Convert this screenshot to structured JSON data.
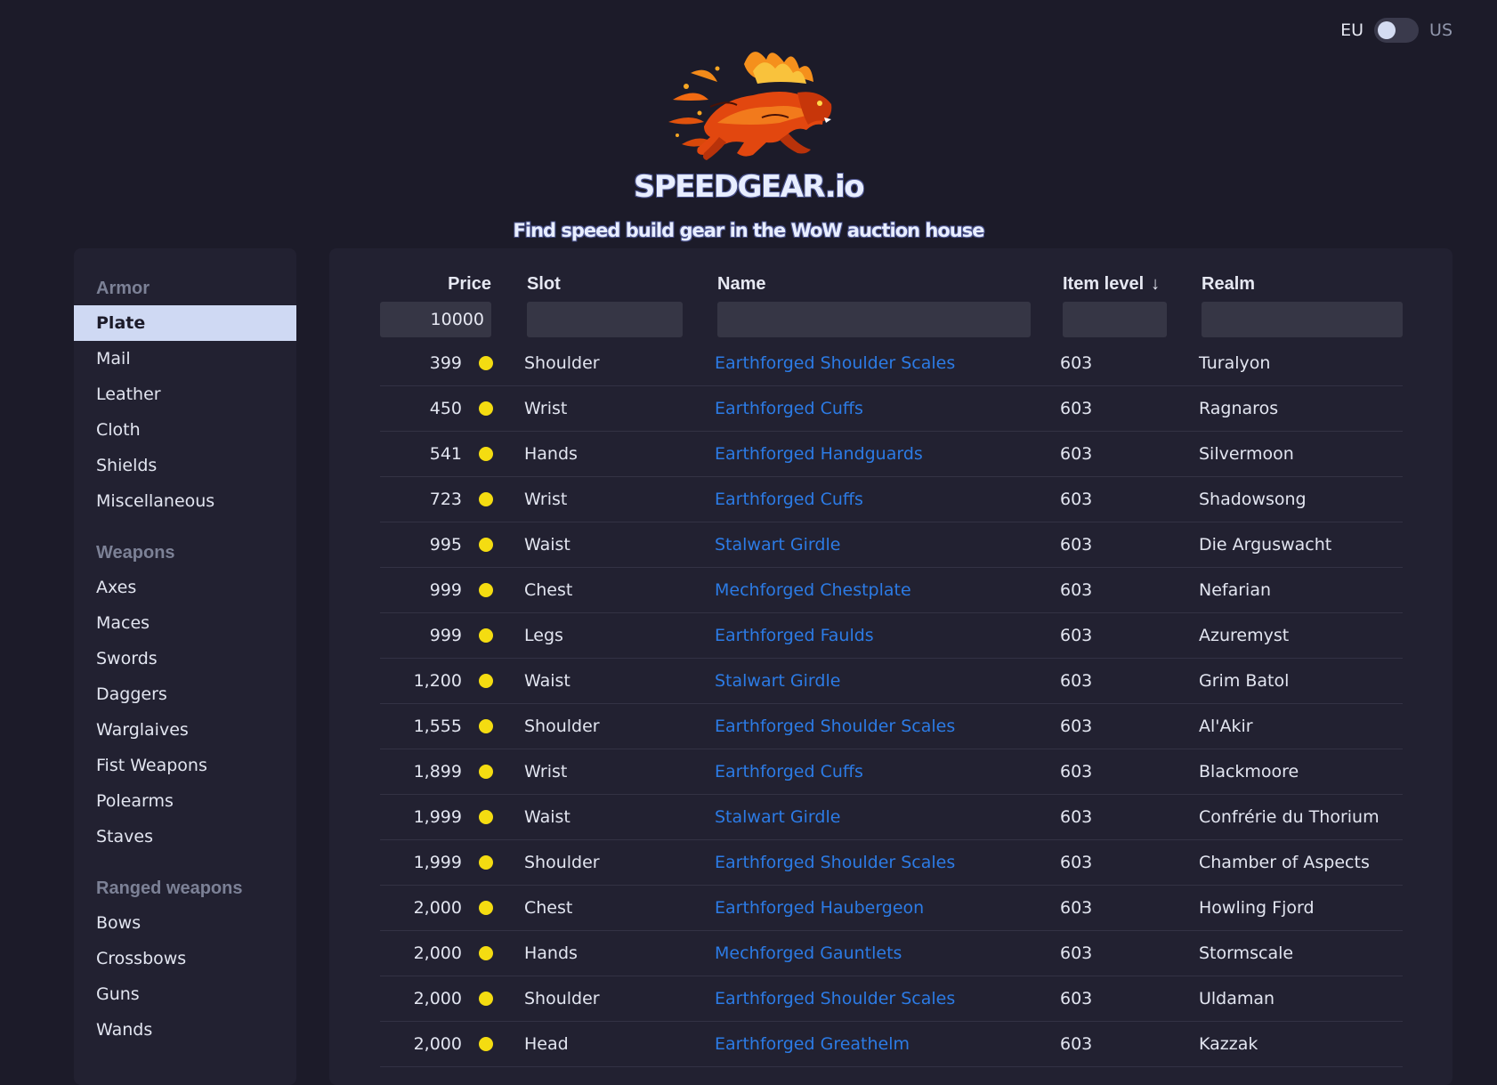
{
  "region": {
    "left": "EU",
    "right": "US"
  },
  "brand": {
    "name": "SPEEDGEAR.io",
    "tagline": "Find speed build gear in the WoW auction house"
  },
  "sidebar": {
    "groups": [
      {
        "title": "Armor",
        "items": [
          "Plate",
          "Mail",
          "Leather",
          "Cloth",
          "Shields",
          "Miscellaneous"
        ]
      },
      {
        "title": "Weapons",
        "items": [
          "Axes",
          "Maces",
          "Swords",
          "Daggers",
          "Warglaives",
          "Fist Weapons",
          "Polearms",
          "Staves"
        ]
      },
      {
        "title": "Ranged weapons",
        "items": [
          "Bows",
          "Crossbows",
          "Guns",
          "Wands"
        ]
      }
    ],
    "active": "Plate"
  },
  "table": {
    "headers": {
      "price": "Price",
      "slot": "Slot",
      "name": "Name",
      "ilvl": "Item level",
      "realm": "Realm"
    },
    "sort_arrow": "↓",
    "filters": {
      "price": "10000",
      "slot": "",
      "name": "",
      "ilvl": "",
      "realm": ""
    },
    "rows": [
      {
        "price": "399",
        "slot": "Shoulder",
        "name": "Earthforged Shoulder Scales",
        "ilvl": "603",
        "realm": "Turalyon"
      },
      {
        "price": "450",
        "slot": "Wrist",
        "name": "Earthforged Cuffs",
        "ilvl": "603",
        "realm": "Ragnaros"
      },
      {
        "price": "541",
        "slot": "Hands",
        "name": "Earthforged Handguards",
        "ilvl": "603",
        "realm": "Silvermoon"
      },
      {
        "price": "723",
        "slot": "Wrist",
        "name": "Earthforged Cuffs",
        "ilvl": "603",
        "realm": "Shadowsong"
      },
      {
        "price": "995",
        "slot": "Waist",
        "name": "Stalwart Girdle",
        "ilvl": "603",
        "realm": "Die Arguswacht"
      },
      {
        "price": "999",
        "slot": "Chest",
        "name": "Mechforged Chestplate",
        "ilvl": "603",
        "realm": "Nefarian"
      },
      {
        "price": "999",
        "slot": "Legs",
        "name": "Earthforged Faulds",
        "ilvl": "603",
        "realm": "Azuremyst"
      },
      {
        "price": "1,200",
        "slot": "Waist",
        "name": "Stalwart Girdle",
        "ilvl": "603",
        "realm": "Grim Batol"
      },
      {
        "price": "1,555",
        "slot": "Shoulder",
        "name": "Earthforged Shoulder Scales",
        "ilvl": "603",
        "realm": "Al'Akir"
      },
      {
        "price": "1,899",
        "slot": "Wrist",
        "name": "Earthforged Cuffs",
        "ilvl": "603",
        "realm": "Blackmoore"
      },
      {
        "price": "1,999",
        "slot": "Waist",
        "name": "Stalwart Girdle",
        "ilvl": "603",
        "realm": "Confrérie du Thorium"
      },
      {
        "price": "1,999",
        "slot": "Shoulder",
        "name": "Earthforged Shoulder Scales",
        "ilvl": "603",
        "realm": "Chamber of Aspects"
      },
      {
        "price": "2,000",
        "slot": "Chest",
        "name": "Earthforged Haubergeon",
        "ilvl": "603",
        "realm": "Howling Fjord"
      },
      {
        "price": "2,000",
        "slot": "Hands",
        "name": "Mechforged Gauntlets",
        "ilvl": "603",
        "realm": "Stormscale"
      },
      {
        "price": "2,000",
        "slot": "Shoulder",
        "name": "Earthforged Shoulder Scales",
        "ilvl": "603",
        "realm": "Uldaman"
      },
      {
        "price": "2,000",
        "slot": "Head",
        "name": "Earthforged Greathelm",
        "ilvl": "603",
        "realm": "Kazzak"
      }
    ]
  },
  "colors": {
    "background": "#1c1b29",
    "panel": "#222131",
    "link": "#2c7be5",
    "coin": "#f4dc11",
    "active_item_bg": "#cfd9f3"
  }
}
